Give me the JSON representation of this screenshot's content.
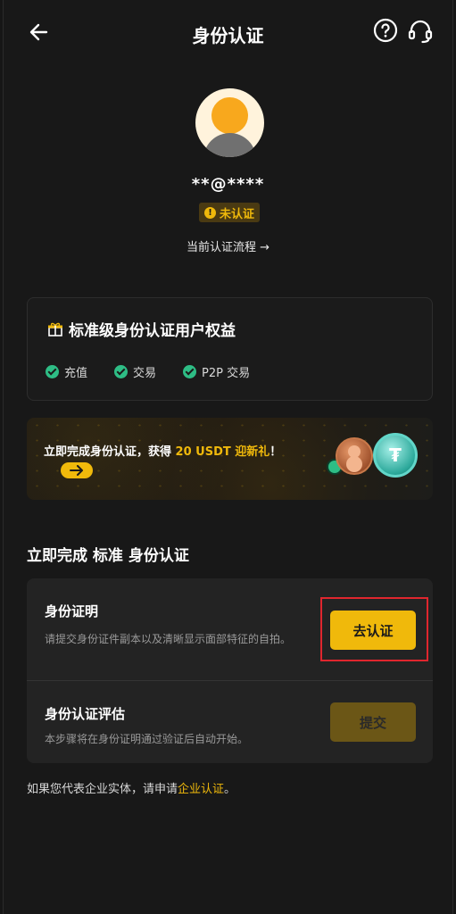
{
  "header": {
    "title": "身份认证",
    "back_icon": "arrow-left-icon",
    "help_icon": "question-circle-icon",
    "support_icon": "headset-icon"
  },
  "profile": {
    "account": "**@****",
    "status_badge": "未认证",
    "status_icon": "exclamation-circle-icon",
    "process_link": "当前认证流程 →"
  },
  "benefits": {
    "title": "标准级身份认证用户权益",
    "title_icon": "gift-icon",
    "items": [
      {
        "label": "充值"
      },
      {
        "label": "交易"
      },
      {
        "label": "P2P 交易"
      }
    ]
  },
  "promo": {
    "text_before": "立即完成身份认证，获得 ",
    "highlight": "20 USDT 迎新礼",
    "text_after": "！",
    "arrow_icon": "arrow-right-icon"
  },
  "section": {
    "title": "立即完成 标准 身份认证"
  },
  "steps": [
    {
      "title": "身份证明",
      "description": "请提交身份证件副本以及清晰显示面部特征的自拍。",
      "button": "去认证",
      "enabled": true
    },
    {
      "title": "身份认证评估",
      "description": "本步骤将在身份证明通过验证后自动开始。",
      "button": "提交",
      "enabled": false
    }
  ],
  "footer": {
    "text": "如果您代表企业实体，请申请",
    "link": "企业认证",
    "end": "。"
  },
  "colors": {
    "accent": "#f0b90b",
    "success": "#2ebd85",
    "background": "#181818",
    "card": "#232323",
    "highlight_border": "#e0262e"
  }
}
